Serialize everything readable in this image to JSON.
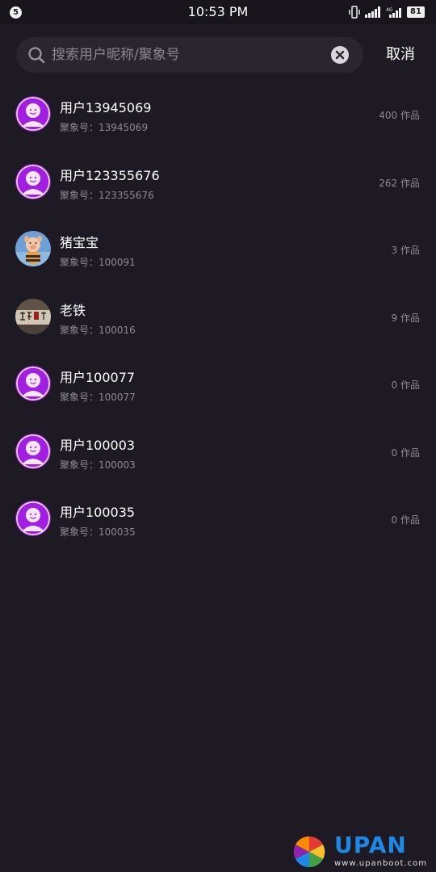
{
  "status_bar": {
    "notification_count": "5",
    "time": "10:53 PM",
    "battery": "81",
    "icons": [
      "vibrate-icon",
      "signal-icon",
      "4g-signal-icon",
      "battery-icon"
    ]
  },
  "search": {
    "placeholder": "搜索用户昵称/聚象号",
    "value": "",
    "cancel_label": "取消"
  },
  "users": [
    {
      "nickname": "用户13945069",
      "id_label": "聚象号：13945069",
      "works": "400 作品",
      "avatar": "default-smiley"
    },
    {
      "nickname": "用户123355676",
      "id_label": "聚象号：123355676",
      "works": "262 作品",
      "avatar": "default-smiley"
    },
    {
      "nickname": "猪宝宝",
      "id_label": "聚象号：100091",
      "works": "3 作品",
      "avatar": "pig-photo"
    },
    {
      "nickname": "老铁",
      "id_label": "聚象号：100016",
      "works": "9 作品",
      "avatar": "calligraphy-photo"
    },
    {
      "nickname": "用户100077",
      "id_label": "聚象号：100077",
      "works": "0 作品",
      "avatar": "default-smiley"
    },
    {
      "nickname": "用户100003",
      "id_label": "聚象号：100003",
      "works": "0 作品",
      "avatar": "default-smiley"
    },
    {
      "nickname": "用户100035",
      "id_label": "聚象号：100035",
      "works": "0 作品",
      "avatar": "default-smiley"
    }
  ],
  "watermark": {
    "brand": "UPAN",
    "url": "www.upanboot.com"
  },
  "colors": {
    "background": "#1e1a24",
    "search_bg": "#2a2630",
    "avatar_purple": "#a21ee0",
    "secondary_text": "#8d8a93"
  }
}
